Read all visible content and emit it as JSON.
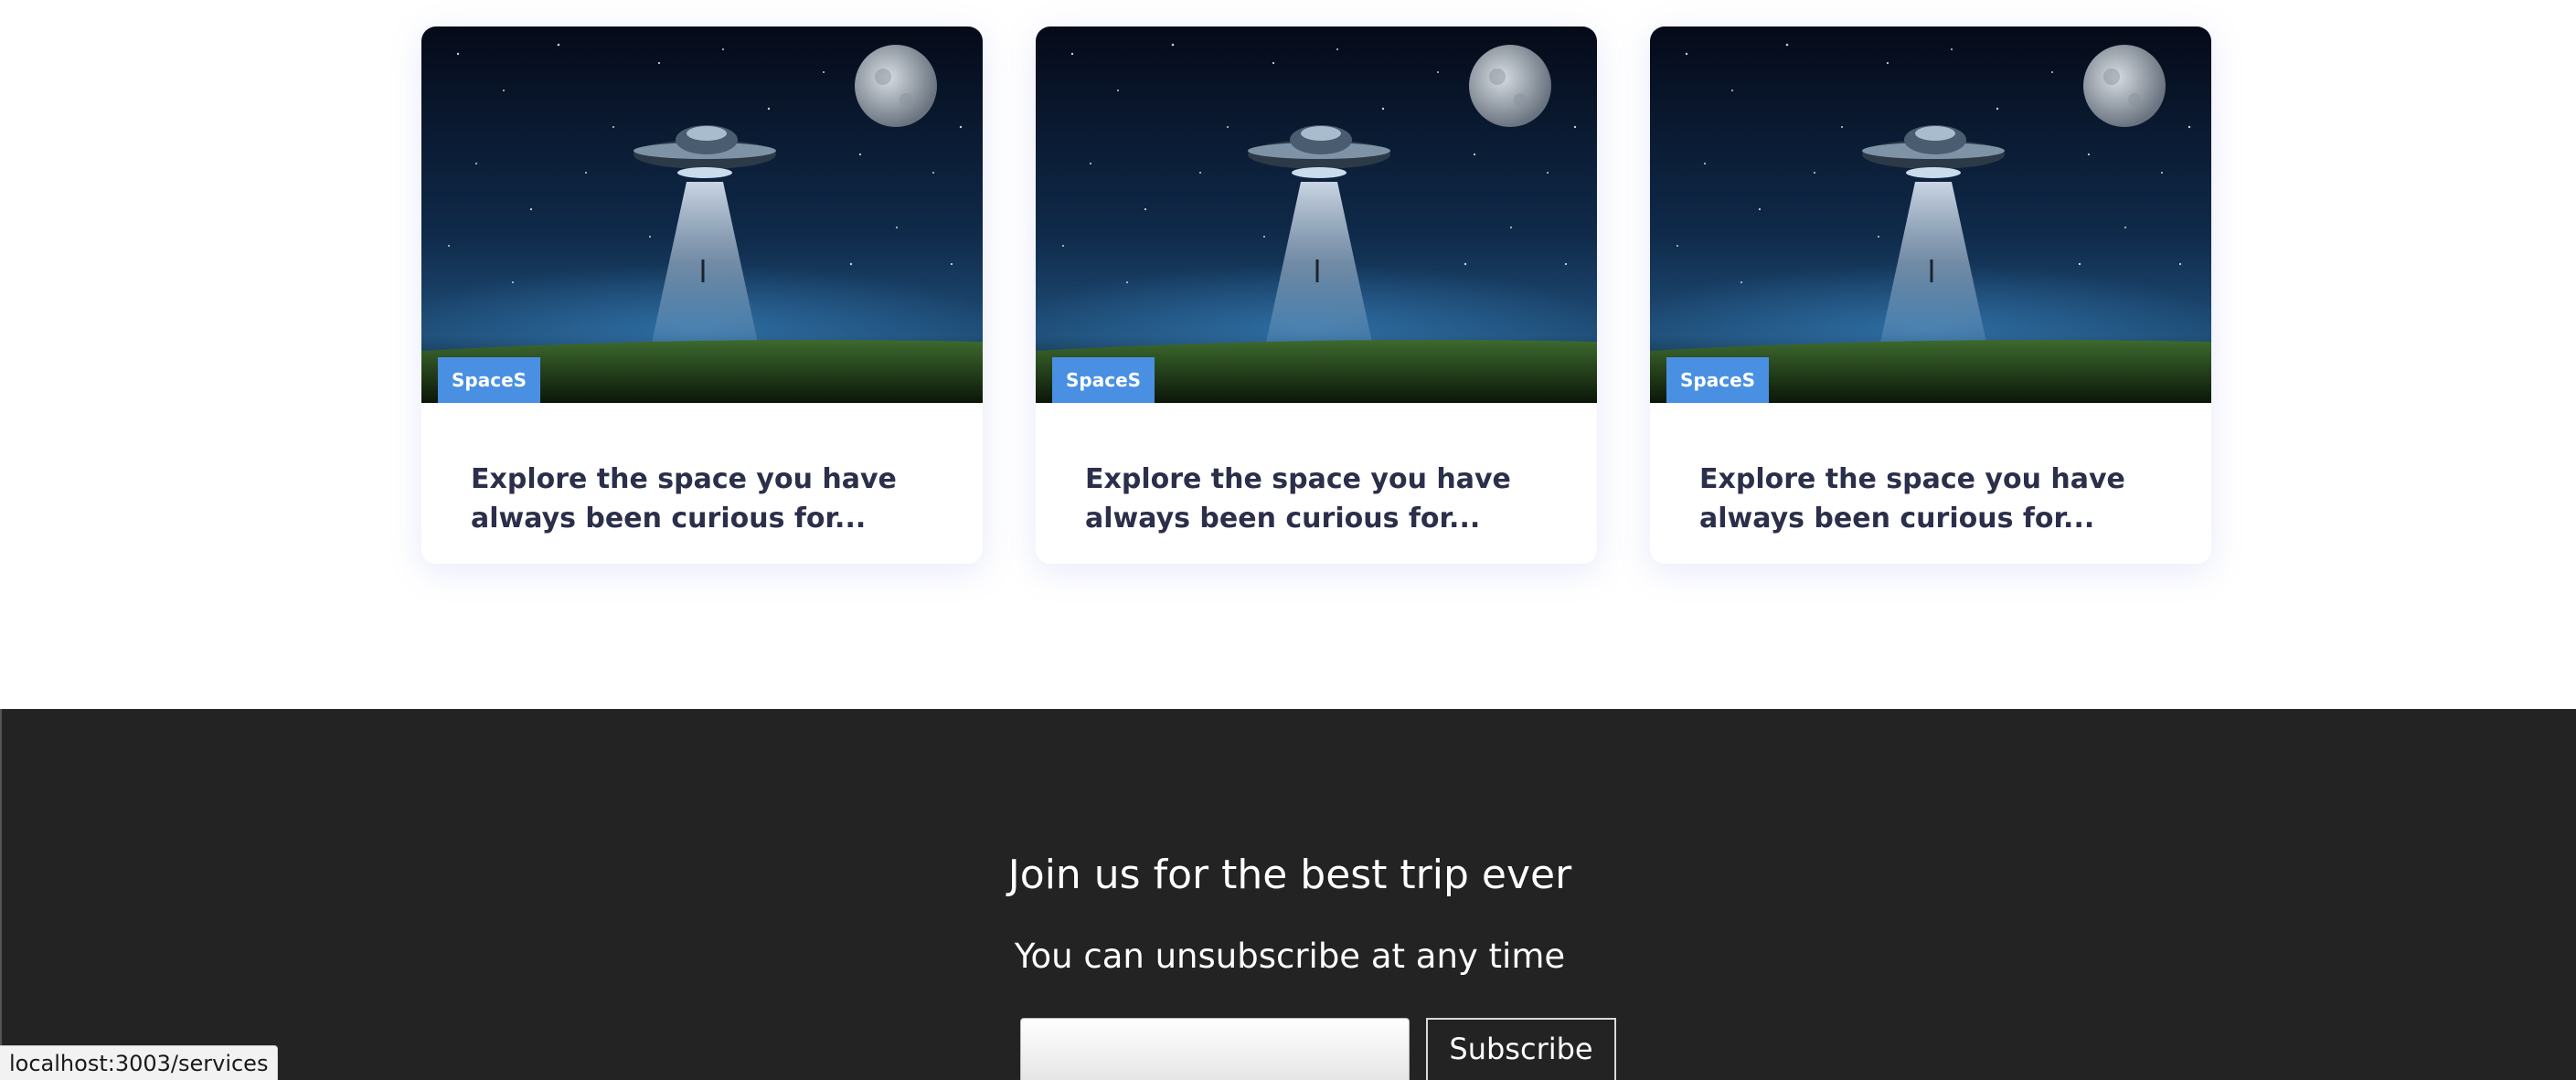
{
  "cards": [
    {
      "tag": "SpaceS",
      "title": "Explore the space you have always been curious for..."
    },
    {
      "tag": "SpaceS",
      "title": "Explore the space you have always been curious for..."
    },
    {
      "tag": "SpaceS",
      "title": "Explore the space you have always been curious for..."
    }
  ],
  "footer": {
    "heading": "Join us for the best trip ever",
    "subheading": "You can unsubscribe at any time",
    "input_value": "",
    "input_placeholder": "",
    "button_label": "Subscribe"
  },
  "status_bar": {
    "url": "localhost:3003/services"
  },
  "colors": {
    "tag_background": "#4a90e2",
    "card_title": "#2b2f4a",
    "footer_background": "#232323"
  }
}
